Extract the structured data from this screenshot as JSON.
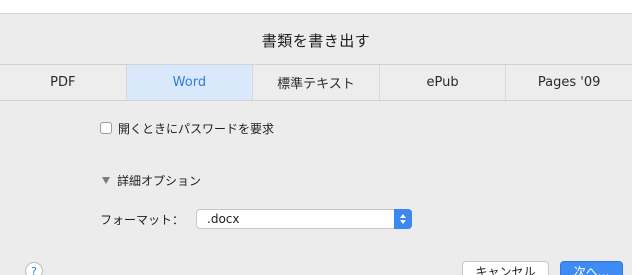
{
  "dialog": {
    "title": "書類を書き出す"
  },
  "tabs": [
    {
      "label": "PDF",
      "active": false
    },
    {
      "label": "Word",
      "active": true
    },
    {
      "label": "標準テキスト",
      "active": false
    },
    {
      "label": "ePub",
      "active": false
    },
    {
      "label": "Pages '09",
      "active": false
    }
  ],
  "options": {
    "password_checkbox_label": "開くときにパスワードを要求",
    "password_checked": false,
    "details_label": "詳細オプション",
    "format_label": "フォーマット：",
    "format_value": ".docx"
  },
  "footer": {
    "help_label": "?",
    "cancel_label": "キャンセル",
    "next_label": "次へ..."
  },
  "colors": {
    "accent": "#3d8bf3",
    "active_tab_bg": "#dae8fb",
    "active_tab_text": "#2f7de1",
    "sheet_bg": "#ececec"
  }
}
